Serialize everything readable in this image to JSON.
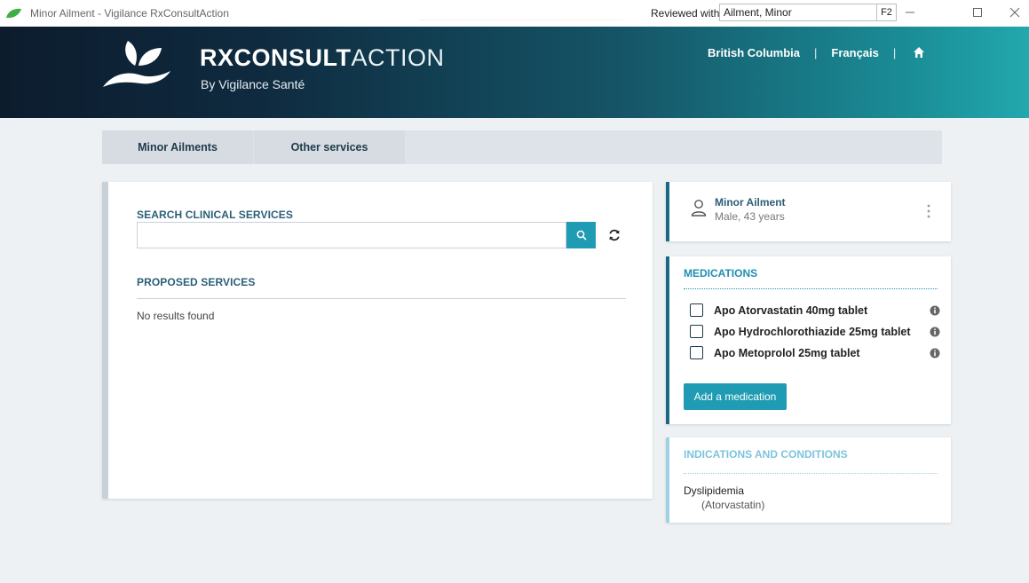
{
  "window": {
    "title": "Minor Ailment - Vigilance RxConsultAction",
    "reviewed_label": "Reviewed with",
    "reviewed_value": "Ailment, Minor",
    "hotkey": "F2"
  },
  "header": {
    "brand_bold": "RXCONSULT",
    "brand_thin": "ACTION",
    "byline": "By Vigilance Santé",
    "nav": {
      "province": "British Columbia",
      "language": "Français",
      "separator": "|"
    }
  },
  "tabs": [
    "Minor Ailments",
    "Other services"
  ],
  "search": {
    "label": "SEARCH CLINICAL SERVICES",
    "value": "",
    "placeholder": ""
  },
  "proposed": {
    "label": "PROPOSED SERVICES",
    "empty_text": "No results found"
  },
  "patient": {
    "name": "Minor Ailment",
    "details": "Male, 43 years"
  },
  "medications": {
    "title": "MEDICATIONS",
    "items": [
      {
        "label": "Apo Atorvastatin 40mg tablet",
        "checked": false
      },
      {
        "label": "Apo Hydrochlorothiazide 25mg tablet",
        "checked": false
      },
      {
        "label": "Apo Metoprolol 25mg tablet",
        "checked": false
      }
    ],
    "add_button": "Add a medication"
  },
  "indications": {
    "title": "INDICATIONS AND CONDITIONS",
    "items": [
      {
        "name": "Dyslipidemia",
        "source": "(Atorvastatin)"
      }
    ]
  },
  "colors": {
    "accent": "#1f9bb3",
    "header_dark": "#0c1c2d",
    "header_teal": "#22a8ad",
    "section_title": "#2a5f77"
  },
  "icons": {
    "app": "leaf-icon",
    "home": "home-icon",
    "search": "search-icon",
    "refresh": "refresh-icon",
    "person": "person-icon",
    "menu": "kebab-menu-icon",
    "info": "info-icon"
  }
}
